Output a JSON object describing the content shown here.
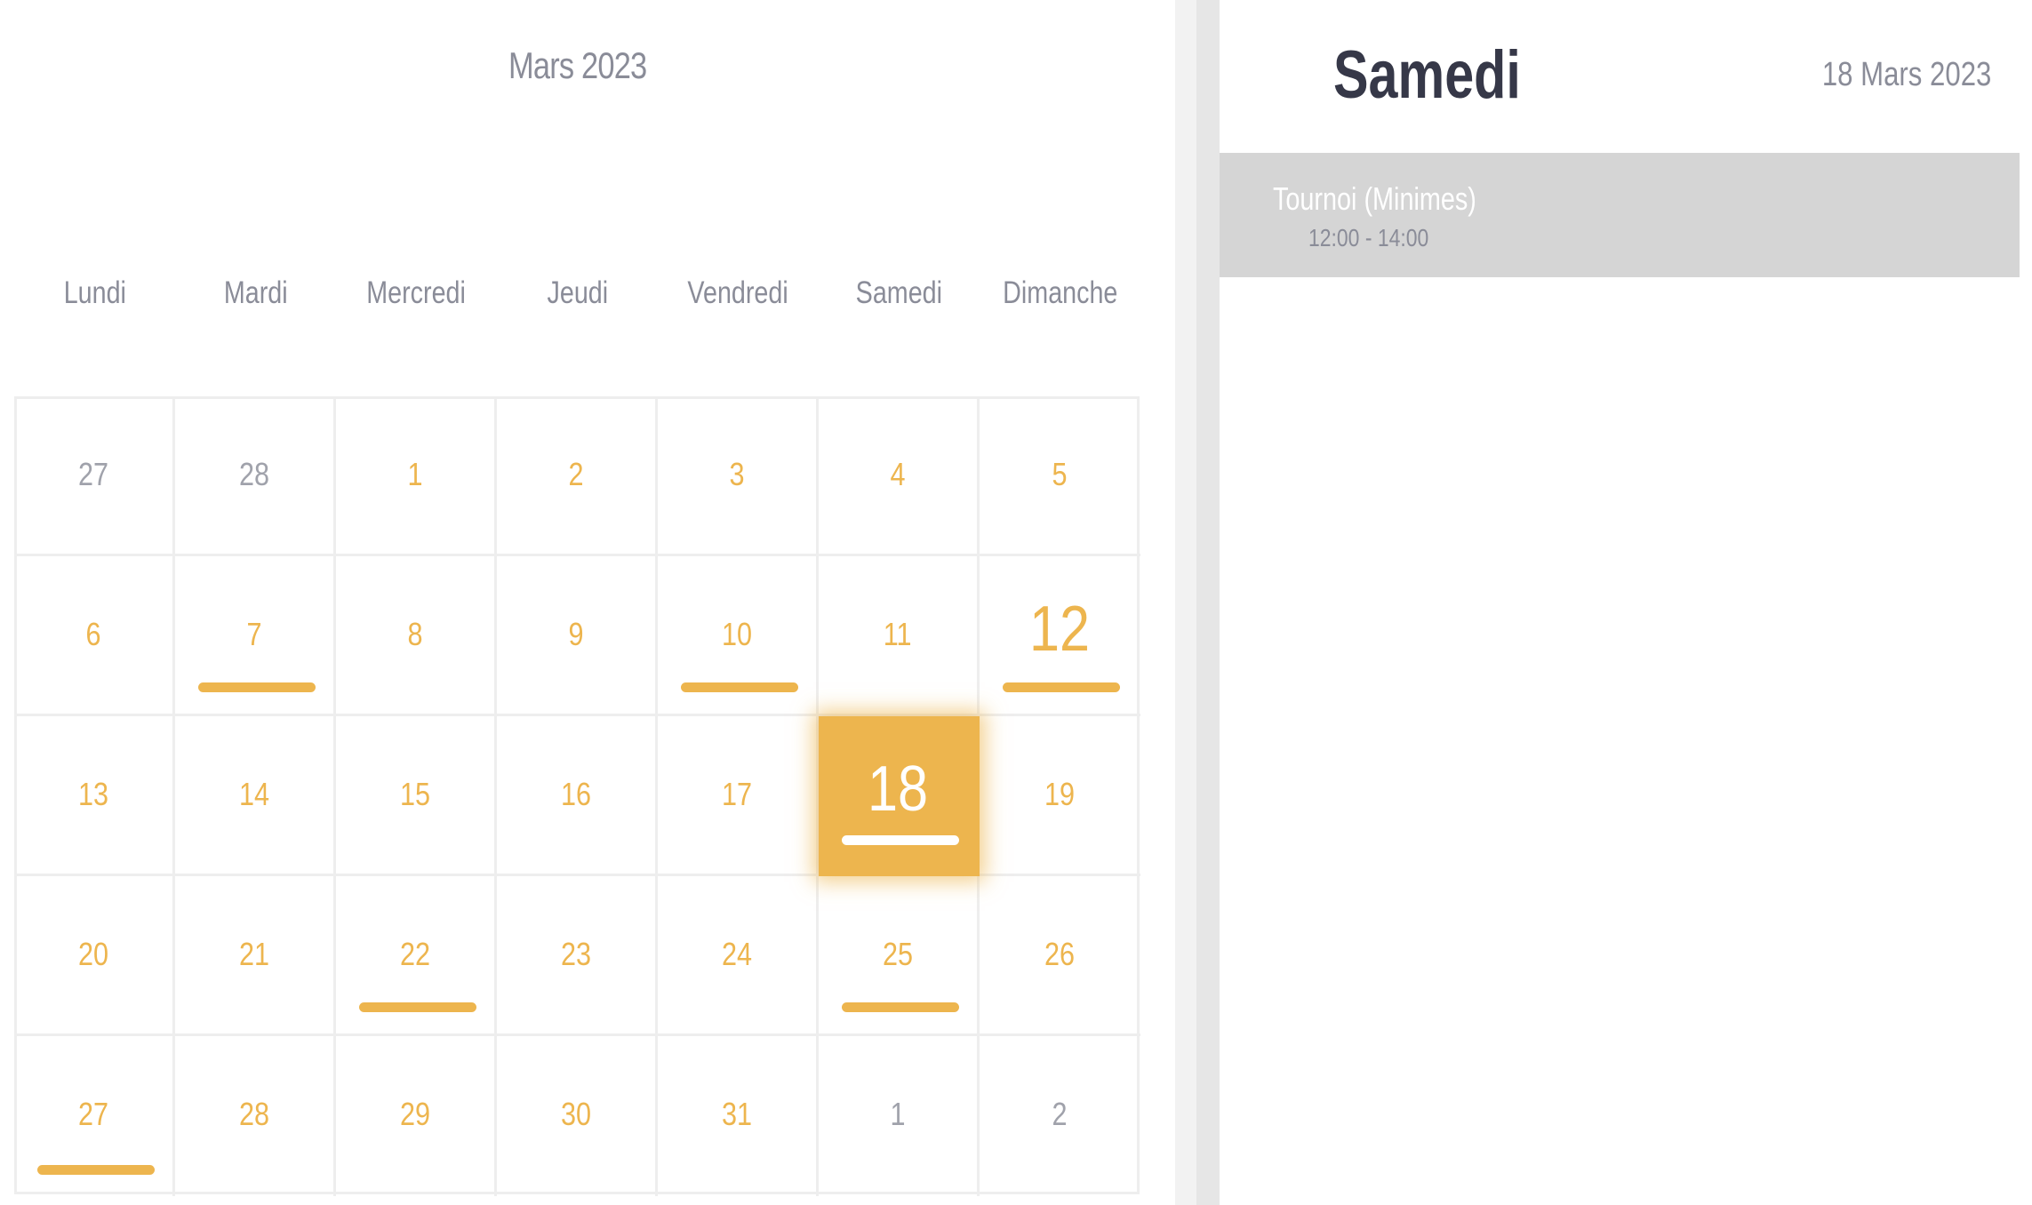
{
  "calendar": {
    "month_title": "Mars 2023",
    "weekdays": [
      "Lundi",
      "Mardi",
      "Mercredi",
      "Jeudi",
      "Vendredi",
      "Samedi",
      "Dimanche"
    ],
    "colors": {
      "accent": "#edb54e",
      "muted_text": "#8a8c98",
      "other_month_text": "#a0a2ab"
    },
    "weeks": [
      [
        {
          "day": "27",
          "other_month": true,
          "has_events": false
        },
        {
          "day": "28",
          "other_month": true,
          "has_events": false
        },
        {
          "day": "1",
          "other_month": false,
          "has_events": false
        },
        {
          "day": "2",
          "other_month": false,
          "has_events": false
        },
        {
          "day": "3",
          "other_month": false,
          "has_events": false
        },
        {
          "day": "4",
          "other_month": false,
          "has_events": false
        },
        {
          "day": "5",
          "other_month": false,
          "has_events": false
        }
      ],
      [
        {
          "day": "6",
          "other_month": false,
          "has_events": false
        },
        {
          "day": "7",
          "other_month": false,
          "has_events": true
        },
        {
          "day": "8",
          "other_month": false,
          "has_events": false
        },
        {
          "day": "9",
          "other_month": false,
          "has_events": false
        },
        {
          "day": "10",
          "other_month": false,
          "has_events": true
        },
        {
          "day": "11",
          "other_month": false,
          "has_events": false
        },
        {
          "day": "12",
          "other_month": false,
          "has_events": true,
          "today": true
        }
      ],
      [
        {
          "day": "13",
          "other_month": false,
          "has_events": false
        },
        {
          "day": "14",
          "other_month": false,
          "has_events": false
        },
        {
          "day": "15",
          "other_month": false,
          "has_events": false
        },
        {
          "day": "16",
          "other_month": false,
          "has_events": false
        },
        {
          "day": "17",
          "other_month": false,
          "has_events": false
        },
        {
          "day": "18",
          "other_month": false,
          "has_events": true,
          "selected": true
        },
        {
          "day": "19",
          "other_month": false,
          "has_events": false
        }
      ],
      [
        {
          "day": "20",
          "other_month": false,
          "has_events": false
        },
        {
          "day": "21",
          "other_month": false,
          "has_events": false
        },
        {
          "day": "22",
          "other_month": false,
          "has_events": true
        },
        {
          "day": "23",
          "other_month": false,
          "has_events": false
        },
        {
          "day": "24",
          "other_month": false,
          "has_events": false
        },
        {
          "day": "25",
          "other_month": false,
          "has_events": true
        },
        {
          "day": "26",
          "other_month": false,
          "has_events": false
        }
      ],
      [
        {
          "day": "27",
          "other_month": false,
          "has_events": true
        },
        {
          "day": "28",
          "other_month": false,
          "has_events": false
        },
        {
          "day": "29",
          "other_month": false,
          "has_events": false
        },
        {
          "day": "30",
          "other_month": false,
          "has_events": false
        },
        {
          "day": "31",
          "other_month": false,
          "has_events": false
        },
        {
          "day": "1",
          "other_month": true,
          "has_events": false
        },
        {
          "day": "2",
          "other_month": true,
          "has_events": false
        }
      ]
    ]
  },
  "day_panel": {
    "day_name": "Samedi",
    "date": "18 Mars 2023",
    "events": [
      {
        "title": "Tournoi (Minimes)",
        "time": "12:00 - 14:00"
      }
    ]
  }
}
